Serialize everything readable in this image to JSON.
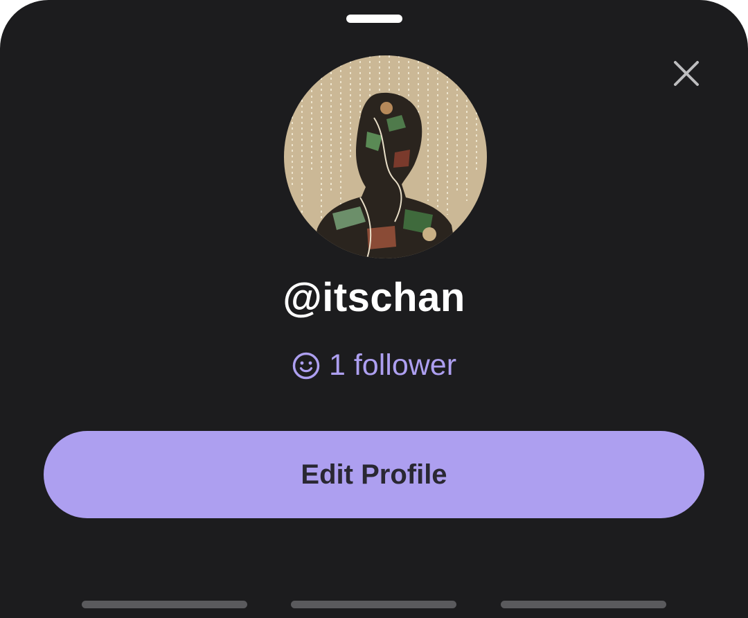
{
  "profile": {
    "username": "@itschan",
    "followers_label": "1 follower",
    "follower_icon": "smiley-face-icon",
    "avatar_description_icon": "profile-avatar"
  },
  "actions": {
    "edit_profile_label": "Edit Profile",
    "close_icon": "close-icon"
  },
  "colors": {
    "background": "#1c1c1e",
    "accent": "#ad9ff0",
    "button_text": "#2a2833",
    "text_primary": "#ffffff",
    "tab_indicator": "#5a5a5d"
  }
}
